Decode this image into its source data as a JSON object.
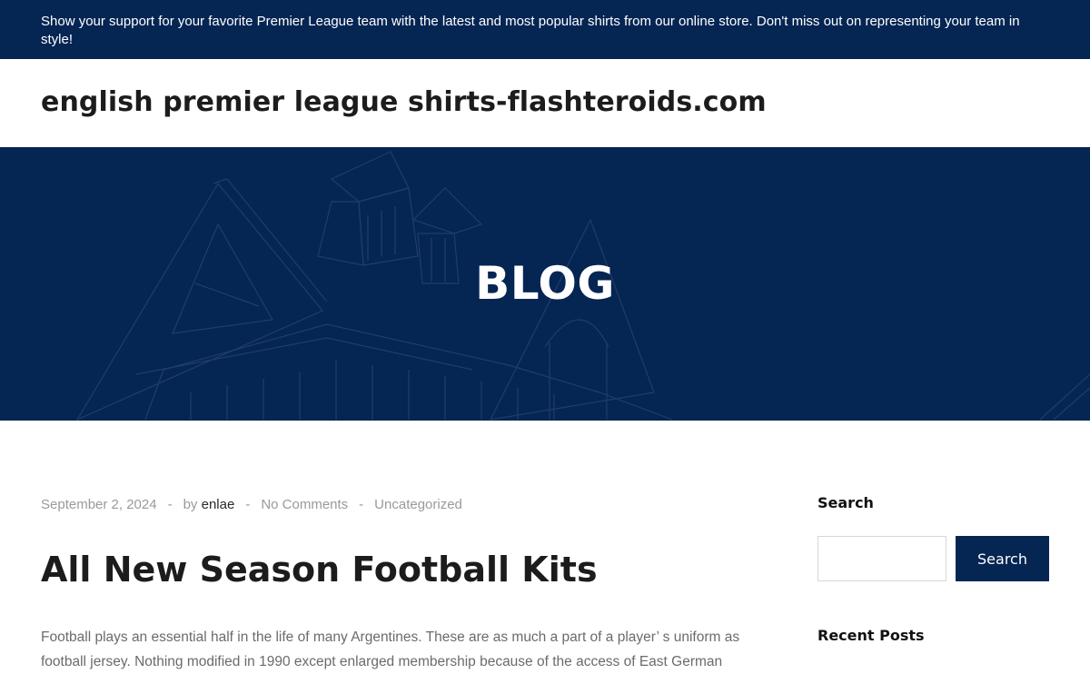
{
  "topbar": {
    "text": "Show your support for your favorite Premier League team with the latest and most popular shirts from our online store. Don't miss out on representing your team in style!"
  },
  "header": {
    "site_title": "english premier league shirts-flashteroids.com"
  },
  "hero": {
    "title": "BLOG"
  },
  "post": {
    "date": "September 2, 2024",
    "separator": "-",
    "by_label": "by",
    "author": "enlae",
    "comments": "No Comments",
    "category": "Uncategorized",
    "title": "All New Season Football Kits",
    "excerpt": "Football plays an essential half in the life of many Argentines. These are as much a part of a player’ s uniform as football jersey. Nothing modified in 1990 except enlarged membership because of the access of East German"
  },
  "sidebar": {
    "search_heading": "Search",
    "search_value": "",
    "search_button": "Search",
    "recent_posts_heading": "Recent Posts"
  },
  "colors": {
    "brand_navy": "#052553",
    "meta_gray": "#9a9a9a",
    "text_dark": "#1c1c1c"
  }
}
